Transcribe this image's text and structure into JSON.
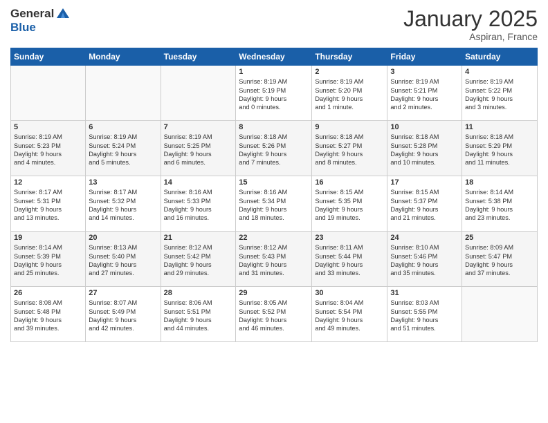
{
  "header": {
    "logo_line1": "General",
    "logo_line2": "Blue",
    "month_title": "January 2025",
    "location": "Aspiran, France"
  },
  "weekdays": [
    "Sunday",
    "Monday",
    "Tuesday",
    "Wednesday",
    "Thursday",
    "Friday",
    "Saturday"
  ],
  "weeks": [
    [
      {
        "day": "",
        "sunrise": "",
        "sunset": "",
        "daylight": "",
        "empty": true
      },
      {
        "day": "",
        "sunrise": "",
        "sunset": "",
        "daylight": "",
        "empty": true
      },
      {
        "day": "",
        "sunrise": "",
        "sunset": "",
        "daylight": "",
        "empty": true
      },
      {
        "day": "1",
        "sunrise": "Sunrise: 8:19 AM",
        "sunset": "Sunset: 5:19 PM",
        "daylight": "Daylight: 9 hours and 0 minutes."
      },
      {
        "day": "2",
        "sunrise": "Sunrise: 8:19 AM",
        "sunset": "Sunset: 5:20 PM",
        "daylight": "Daylight: 9 hours and 1 minute."
      },
      {
        "day": "3",
        "sunrise": "Sunrise: 8:19 AM",
        "sunset": "Sunset: 5:21 PM",
        "daylight": "Daylight: 9 hours and 2 minutes."
      },
      {
        "day": "4",
        "sunrise": "Sunrise: 8:19 AM",
        "sunset": "Sunset: 5:22 PM",
        "daylight": "Daylight: 9 hours and 3 minutes."
      }
    ],
    [
      {
        "day": "5",
        "sunrise": "Sunrise: 8:19 AM",
        "sunset": "Sunset: 5:23 PM",
        "daylight": "Daylight: 9 hours and 4 minutes."
      },
      {
        "day": "6",
        "sunrise": "Sunrise: 8:19 AM",
        "sunset": "Sunset: 5:24 PM",
        "daylight": "Daylight: 9 hours and 5 minutes."
      },
      {
        "day": "7",
        "sunrise": "Sunrise: 8:19 AM",
        "sunset": "Sunset: 5:25 PM",
        "daylight": "Daylight: 9 hours and 6 minutes."
      },
      {
        "day": "8",
        "sunrise": "Sunrise: 8:18 AM",
        "sunset": "Sunset: 5:26 PM",
        "daylight": "Daylight: 9 hours and 7 minutes."
      },
      {
        "day": "9",
        "sunrise": "Sunrise: 8:18 AM",
        "sunset": "Sunset: 5:27 PM",
        "daylight": "Daylight: 9 hours and 8 minutes."
      },
      {
        "day": "10",
        "sunrise": "Sunrise: 8:18 AM",
        "sunset": "Sunset: 5:28 PM",
        "daylight": "Daylight: 9 hours and 10 minutes."
      },
      {
        "day": "11",
        "sunrise": "Sunrise: 8:18 AM",
        "sunset": "Sunset: 5:29 PM",
        "daylight": "Daylight: 9 hours and 11 minutes."
      }
    ],
    [
      {
        "day": "12",
        "sunrise": "Sunrise: 8:17 AM",
        "sunset": "Sunset: 5:31 PM",
        "daylight": "Daylight: 9 hours and 13 minutes."
      },
      {
        "day": "13",
        "sunrise": "Sunrise: 8:17 AM",
        "sunset": "Sunset: 5:32 PM",
        "daylight": "Daylight: 9 hours and 14 minutes."
      },
      {
        "day": "14",
        "sunrise": "Sunrise: 8:16 AM",
        "sunset": "Sunset: 5:33 PM",
        "daylight": "Daylight: 9 hours and 16 minutes."
      },
      {
        "day": "15",
        "sunrise": "Sunrise: 8:16 AM",
        "sunset": "Sunset: 5:34 PM",
        "daylight": "Daylight: 9 hours and 18 minutes."
      },
      {
        "day": "16",
        "sunrise": "Sunrise: 8:15 AM",
        "sunset": "Sunset: 5:35 PM",
        "daylight": "Daylight: 9 hours and 19 minutes."
      },
      {
        "day": "17",
        "sunrise": "Sunrise: 8:15 AM",
        "sunset": "Sunset: 5:37 PM",
        "daylight": "Daylight: 9 hours and 21 minutes."
      },
      {
        "day": "18",
        "sunrise": "Sunrise: 8:14 AM",
        "sunset": "Sunset: 5:38 PM",
        "daylight": "Daylight: 9 hours and 23 minutes."
      }
    ],
    [
      {
        "day": "19",
        "sunrise": "Sunrise: 8:14 AM",
        "sunset": "Sunset: 5:39 PM",
        "daylight": "Daylight: 9 hours and 25 minutes."
      },
      {
        "day": "20",
        "sunrise": "Sunrise: 8:13 AM",
        "sunset": "Sunset: 5:40 PM",
        "daylight": "Daylight: 9 hours and 27 minutes."
      },
      {
        "day": "21",
        "sunrise": "Sunrise: 8:12 AM",
        "sunset": "Sunset: 5:42 PM",
        "daylight": "Daylight: 9 hours and 29 minutes."
      },
      {
        "day": "22",
        "sunrise": "Sunrise: 8:12 AM",
        "sunset": "Sunset: 5:43 PM",
        "daylight": "Daylight: 9 hours and 31 minutes."
      },
      {
        "day": "23",
        "sunrise": "Sunrise: 8:11 AM",
        "sunset": "Sunset: 5:44 PM",
        "daylight": "Daylight: 9 hours and 33 minutes."
      },
      {
        "day": "24",
        "sunrise": "Sunrise: 8:10 AM",
        "sunset": "Sunset: 5:46 PM",
        "daylight": "Daylight: 9 hours and 35 minutes."
      },
      {
        "day": "25",
        "sunrise": "Sunrise: 8:09 AM",
        "sunset": "Sunset: 5:47 PM",
        "daylight": "Daylight: 9 hours and 37 minutes."
      }
    ],
    [
      {
        "day": "26",
        "sunrise": "Sunrise: 8:08 AM",
        "sunset": "Sunset: 5:48 PM",
        "daylight": "Daylight: 9 hours and 39 minutes."
      },
      {
        "day": "27",
        "sunrise": "Sunrise: 8:07 AM",
        "sunset": "Sunset: 5:49 PM",
        "daylight": "Daylight: 9 hours and 42 minutes."
      },
      {
        "day": "28",
        "sunrise": "Sunrise: 8:06 AM",
        "sunset": "Sunset: 5:51 PM",
        "daylight": "Daylight: 9 hours and 44 minutes."
      },
      {
        "day": "29",
        "sunrise": "Sunrise: 8:05 AM",
        "sunset": "Sunset: 5:52 PM",
        "daylight": "Daylight: 9 hours and 46 minutes."
      },
      {
        "day": "30",
        "sunrise": "Sunrise: 8:04 AM",
        "sunset": "Sunset: 5:54 PM",
        "daylight": "Daylight: 9 hours and 49 minutes."
      },
      {
        "day": "31",
        "sunrise": "Sunrise: 8:03 AM",
        "sunset": "Sunset: 5:55 PM",
        "daylight": "Daylight: 9 hours and 51 minutes."
      },
      {
        "day": "",
        "sunrise": "",
        "sunset": "",
        "daylight": "",
        "empty": true
      }
    ]
  ]
}
